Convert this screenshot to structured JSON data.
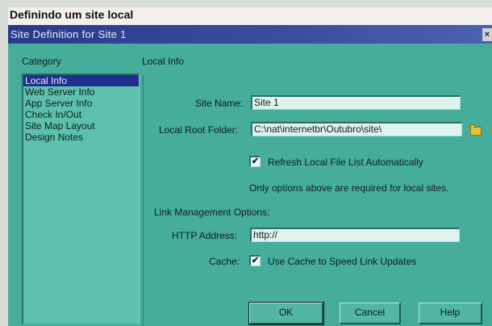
{
  "caption": "Definindo um site local",
  "dialog": {
    "title": "Site Definition for Site 1",
    "close_glyph": "×"
  },
  "category": {
    "header": "Category",
    "items": [
      {
        "label": "Local Info",
        "selected": true
      },
      {
        "label": "Web Server Info",
        "selected": false
      },
      {
        "label": "App Server Info",
        "selected": false
      },
      {
        "label": "Check In/Out",
        "selected": false
      },
      {
        "label": "Site Map Layout",
        "selected": false
      },
      {
        "label": "Design Notes",
        "selected": false
      }
    ]
  },
  "panel": {
    "title": "Local Info",
    "site_name_label": "Site Name:",
    "site_name_value": "Site 1",
    "local_root_label": "Local Root Folder:",
    "local_root_value": "C:\\nat\\internetbr\\Outubro\\site\\",
    "refresh_label": "Refresh Local File List Automatically",
    "refresh_checked": true,
    "note": "Only options above are required for local sites.",
    "link_section_title": "Link Management Options:",
    "http_label": "HTTP Address:",
    "http_value": "http://",
    "cache_label": "Cache:",
    "cache_option_label": "Use Cache to Speed Link Updates",
    "cache_checked": true
  },
  "buttons": {
    "ok": "OK",
    "cancel": "Cancel",
    "help": "Help"
  },
  "check_glyph": "✔",
  "colors": {
    "dialog_bg": "#45ad9a",
    "titlebar": "#2a3a8a",
    "selection": "#1f2f8f"
  }
}
